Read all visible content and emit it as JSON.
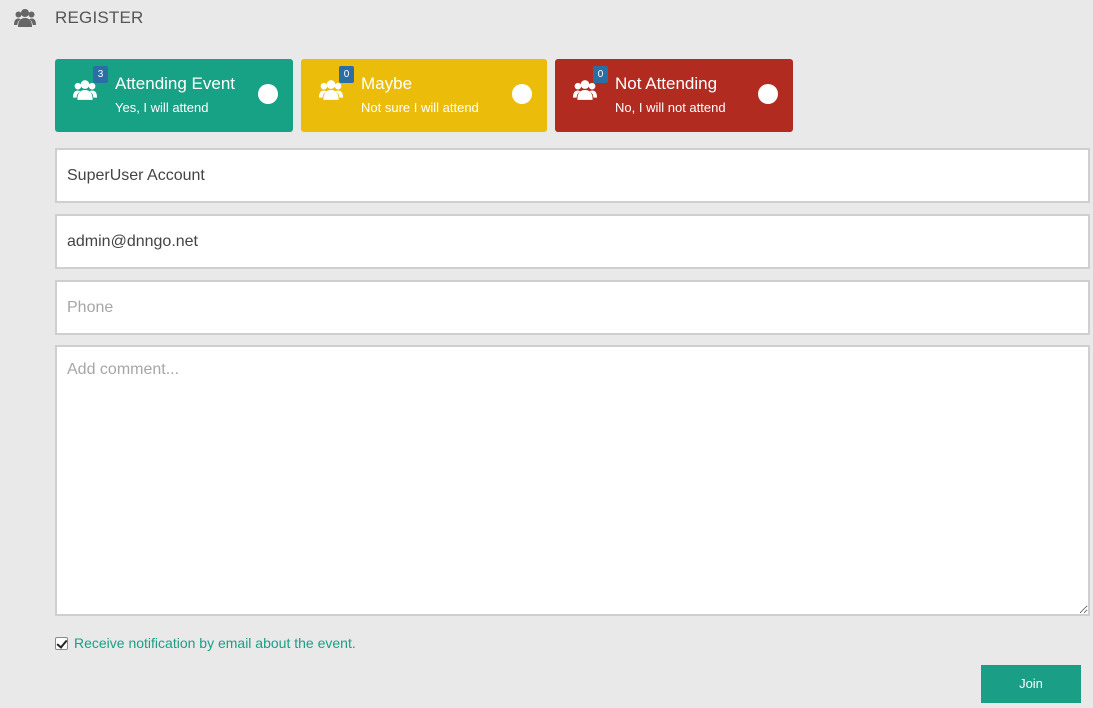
{
  "header": {
    "icon": "users-icon",
    "title": "REGISTER"
  },
  "status_options": [
    {
      "count": "3",
      "title": "Attending Event",
      "subtitle": "Yes, I will attend",
      "icon": "users-icon",
      "color": "#17a185",
      "selected": false
    },
    {
      "count": "0",
      "title": "Maybe",
      "subtitle": "Not sure I will attend",
      "icon": "users-icon",
      "color": "#ebbc09",
      "selected": false
    },
    {
      "count": "0",
      "title": "Not Attending",
      "subtitle": "No, I will not attend",
      "icon": "users-icon",
      "color": "#b22b21",
      "selected": false
    }
  ],
  "form": {
    "name_value": "SuperUser Account",
    "email_value": "admin@dnngo.net",
    "phone_placeholder": "Phone",
    "comment_placeholder": "Add comment..."
  },
  "notification": {
    "checked": true,
    "label": "Receive notification by email about the event."
  },
  "join_label": "Join",
  "colors": {
    "accent": "#1a9f86",
    "badge": "#2b6ea6",
    "background": "#e9e9e9"
  }
}
